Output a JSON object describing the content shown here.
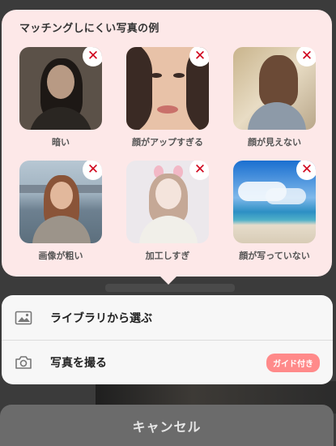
{
  "popover": {
    "title": "マッチングしにくい写真の例",
    "examples": [
      {
        "caption": "暗い",
        "badge": "✕"
      },
      {
        "caption": "顔がアップすぎる",
        "badge": "✕"
      },
      {
        "caption": "顔が見えない",
        "badge": "✕"
      },
      {
        "caption": "画像が粗い",
        "badge": "✕"
      },
      {
        "caption": "加工しすぎ",
        "badge": "✕"
      },
      {
        "caption": "顔が写っていない",
        "badge": "✕"
      }
    ]
  },
  "actions": {
    "library": {
      "label": "ライブラリから選ぶ",
      "icon": "image-icon"
    },
    "camera": {
      "label": "写真を撮る",
      "icon": "camera-icon",
      "badge": "ガイド付き"
    }
  },
  "cancel_label": "キャンセル",
  "colors": {
    "accent": "#d0021b",
    "badge": "#ff8a8a",
    "popover_bg": "#fde8e8"
  }
}
